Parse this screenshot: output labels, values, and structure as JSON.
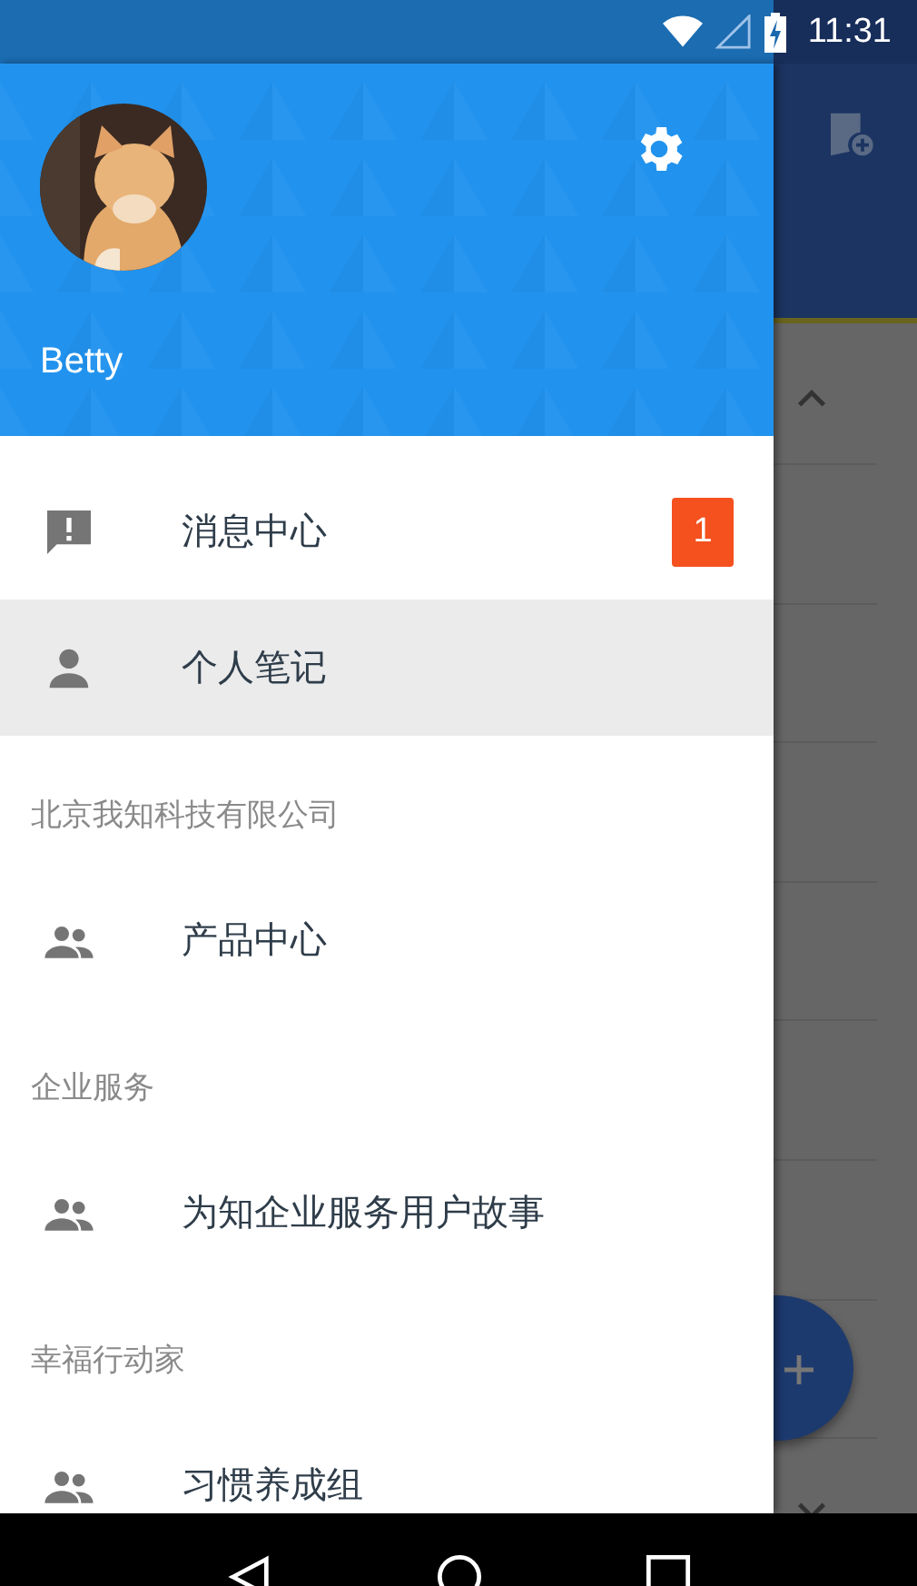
{
  "status_bar": {
    "time": "11:31"
  },
  "drawer": {
    "user_name": "Betty",
    "items": [
      {
        "kind": "message",
        "label": "消息中心",
        "badge": "1",
        "selected": false
      },
      {
        "kind": "person",
        "label": "个人笔记",
        "selected": true
      }
    ],
    "groups": [
      {
        "title": "北京我知科技有限公司",
        "items": [
          {
            "kind": "group",
            "label": "产品中心",
            "selected": false
          }
        ]
      },
      {
        "title": "企业服务",
        "items": [
          {
            "kind": "group",
            "label": "为知企业服务用户故事",
            "selected": false
          }
        ]
      },
      {
        "title": "幸福行动家",
        "items": [
          {
            "kind": "group",
            "label": "习惯养成组",
            "selected": false
          }
        ]
      }
    ]
  }
}
